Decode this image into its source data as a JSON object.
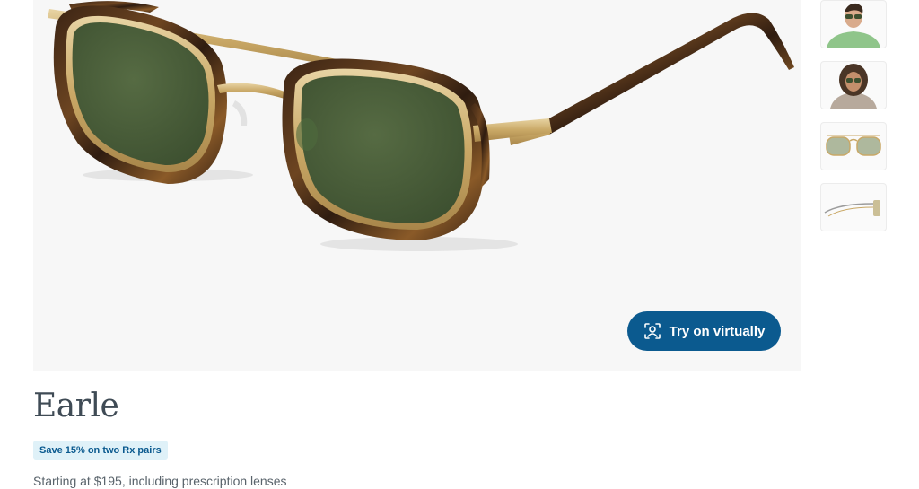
{
  "product": {
    "name": "Earle",
    "promo_badge": "Save 15% on two Rx pairs",
    "price_text": "Starting at $195, including prescription lenses"
  },
  "hero": {
    "try_on_label": "Try on virtually",
    "try_on_icon": "face-scan-icon"
  },
  "thumbnails": [
    {
      "name": "model-man-green-shirt"
    },
    {
      "name": "model-woman-curly-hair"
    },
    {
      "name": "front-view-glasses"
    },
    {
      "name": "side-view-glasses"
    }
  ],
  "colors": {
    "accent": "#0b5a8f",
    "promo_bg": "#dff1f8",
    "lens": "#4a5e3a",
    "frame_gold": "#c9a866",
    "tortoise": "#5a3a20"
  }
}
